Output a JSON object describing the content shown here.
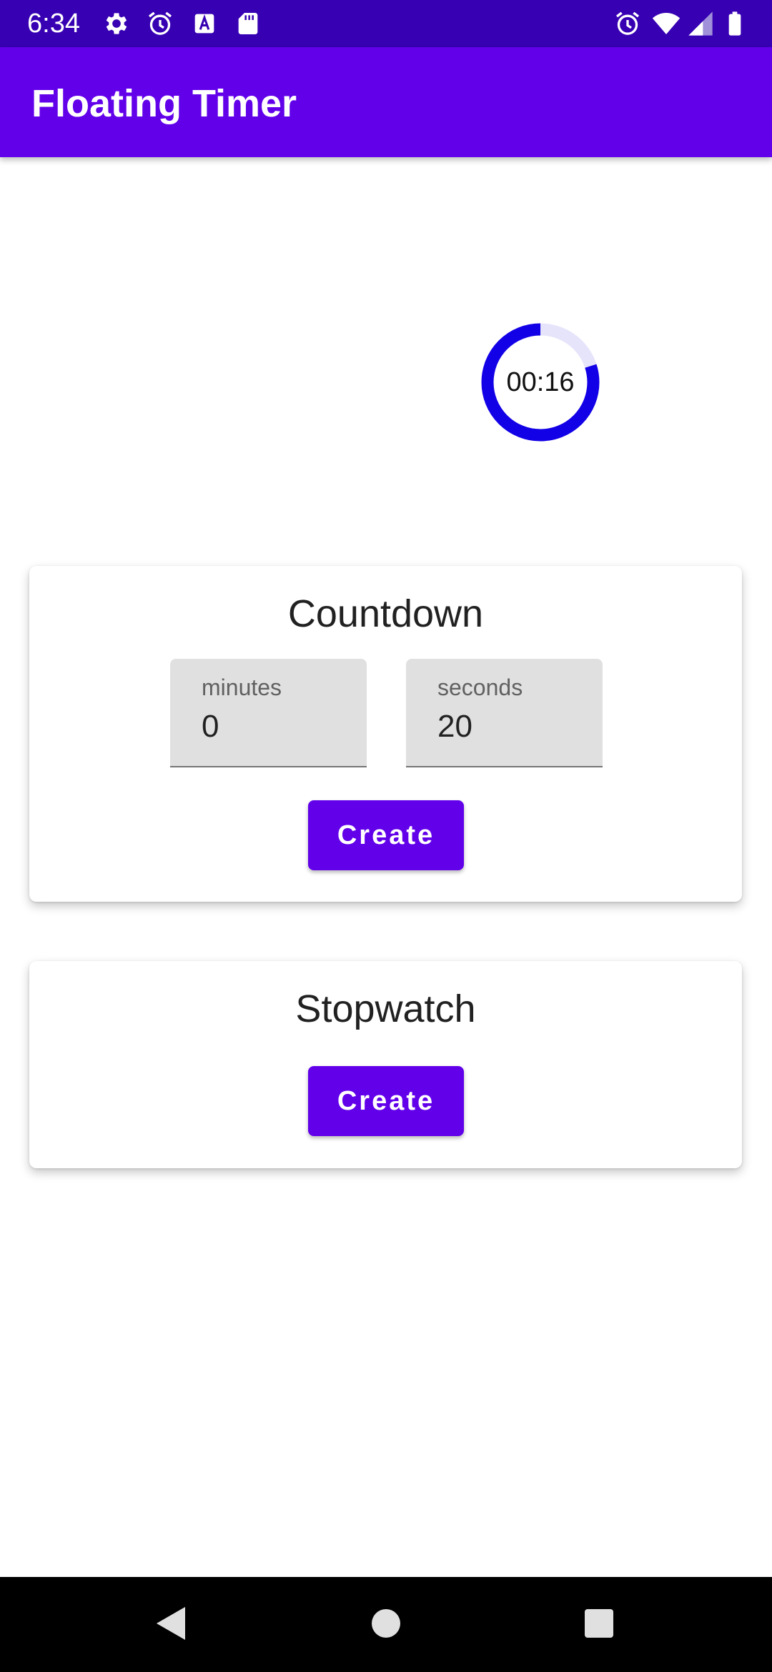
{
  "status_bar": {
    "time": "6:34",
    "left_icons": [
      "settings-icon",
      "alarm-icon",
      "text-a-icon",
      "sd-card-icon"
    ],
    "right_icons": [
      "alarm-icon",
      "wifi-icon",
      "signal-icon",
      "battery-icon"
    ]
  },
  "app_bar": {
    "title": "Floating Timer"
  },
  "floating_timer": {
    "time": "00:16",
    "progress_fraction": 0.8,
    "ring_color": "#1200e6",
    "track_color": "#e6e4fb"
  },
  "countdown": {
    "title": "Countdown",
    "minutes_label": "minutes",
    "minutes_value": "0",
    "seconds_label": "seconds",
    "seconds_value": "20",
    "create_label": "Create"
  },
  "stopwatch": {
    "title": "Stopwatch",
    "create_label": "Create"
  },
  "colors": {
    "status_bar": "#3700b3",
    "app_bar": "#6200ea",
    "button": "#6200ea"
  },
  "nav_bar": {
    "icons": [
      "back-icon",
      "home-icon",
      "recents-icon"
    ]
  }
}
